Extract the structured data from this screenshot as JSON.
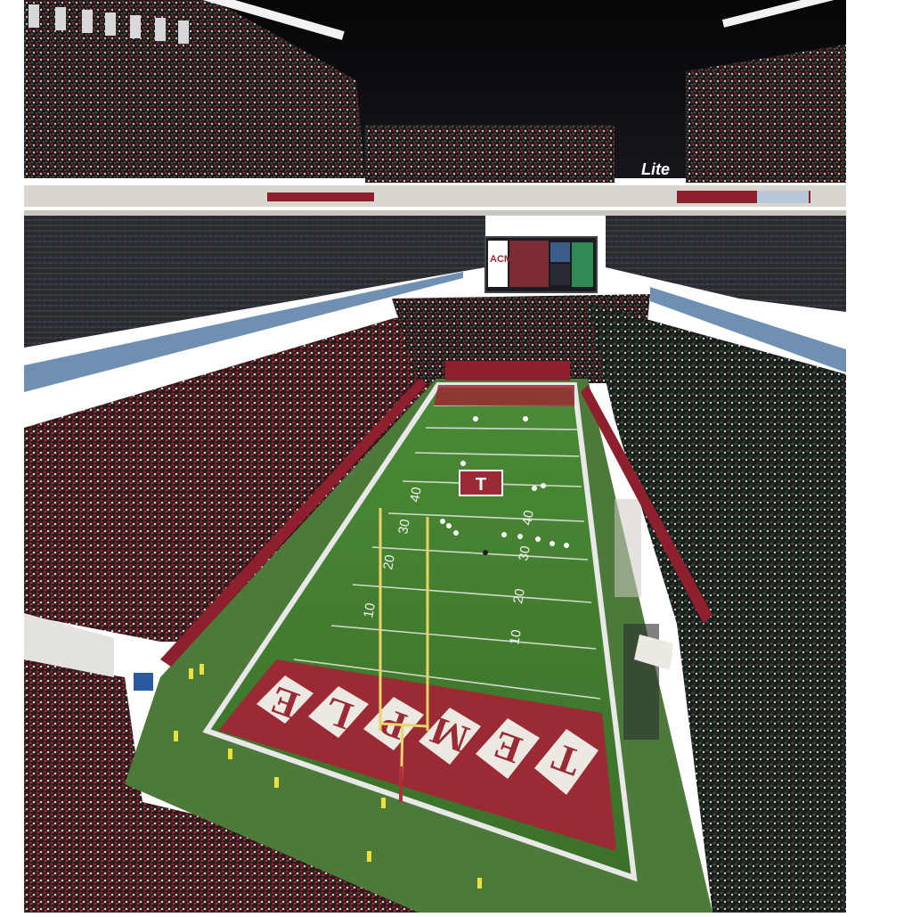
{
  "scene": {
    "scoreboard_brand": "ACME",
    "beer_sign": "Lite",
    "midfield_logo": "T",
    "endzone_word": "TEMPLE",
    "yard_numbers_left": [
      "10",
      "20",
      "40",
      "30"
    ],
    "yard_numbers_right": [
      "10",
      "20",
      "30",
      "40"
    ],
    "colors": {
      "turf": "#3f7a2c",
      "turf_dark": "#346a24",
      "endzone": "#9a2a33",
      "cherry_fans": "#6d2128",
      "green_fans": "#2b4a33",
      "night_sky": "#0b0b10"
    }
  }
}
